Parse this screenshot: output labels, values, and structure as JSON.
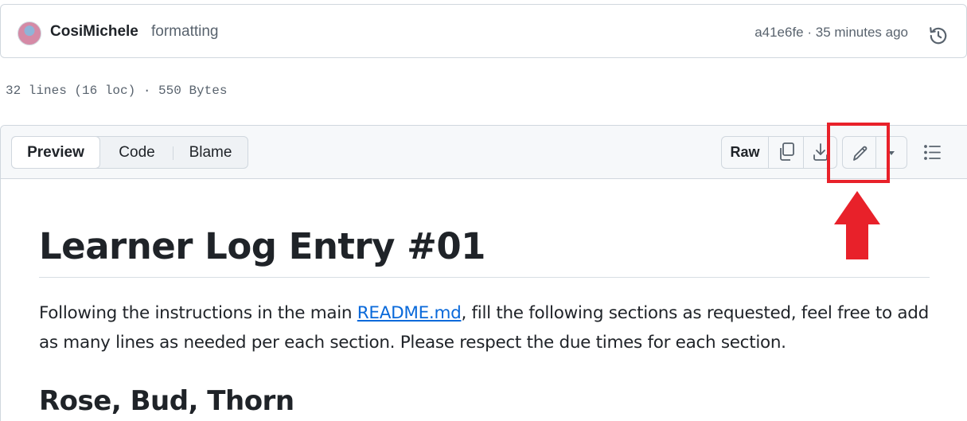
{
  "commit": {
    "author": "CosiMichele",
    "message": "formatting",
    "meta": "a41e6fe · 35 minutes ago"
  },
  "file_info": "32 lines (16 loc) · 550 Bytes",
  "view_tabs": [
    {
      "label": "Preview",
      "active": true
    },
    {
      "label": "Code",
      "active": false
    },
    {
      "label": "Blame",
      "active": false
    }
  ],
  "toolbar": {
    "raw_label": "Raw",
    "icons": [
      "copy-icon",
      "download-icon",
      "pencil-icon",
      "triangle-down-icon",
      "list-unordered-icon",
      "history-icon"
    ]
  },
  "annotation": {
    "color": "#e8212a"
  },
  "markdown": {
    "h1": "Learner Log Entry #01",
    "para_before": "Following the instructions in the main ",
    "link": "README.md",
    "para_after": ", fill the following sections as requested, feel free to add as many lines as needed per each section. Please respect the due times for each section.",
    "h2": "Rose, Bud, Thorn"
  },
  "colors": {
    "link": "#0969da",
    "border": "#d0d7de",
    "header_bg": "#f6f8fa",
    "muted_text": "#59636e"
  }
}
